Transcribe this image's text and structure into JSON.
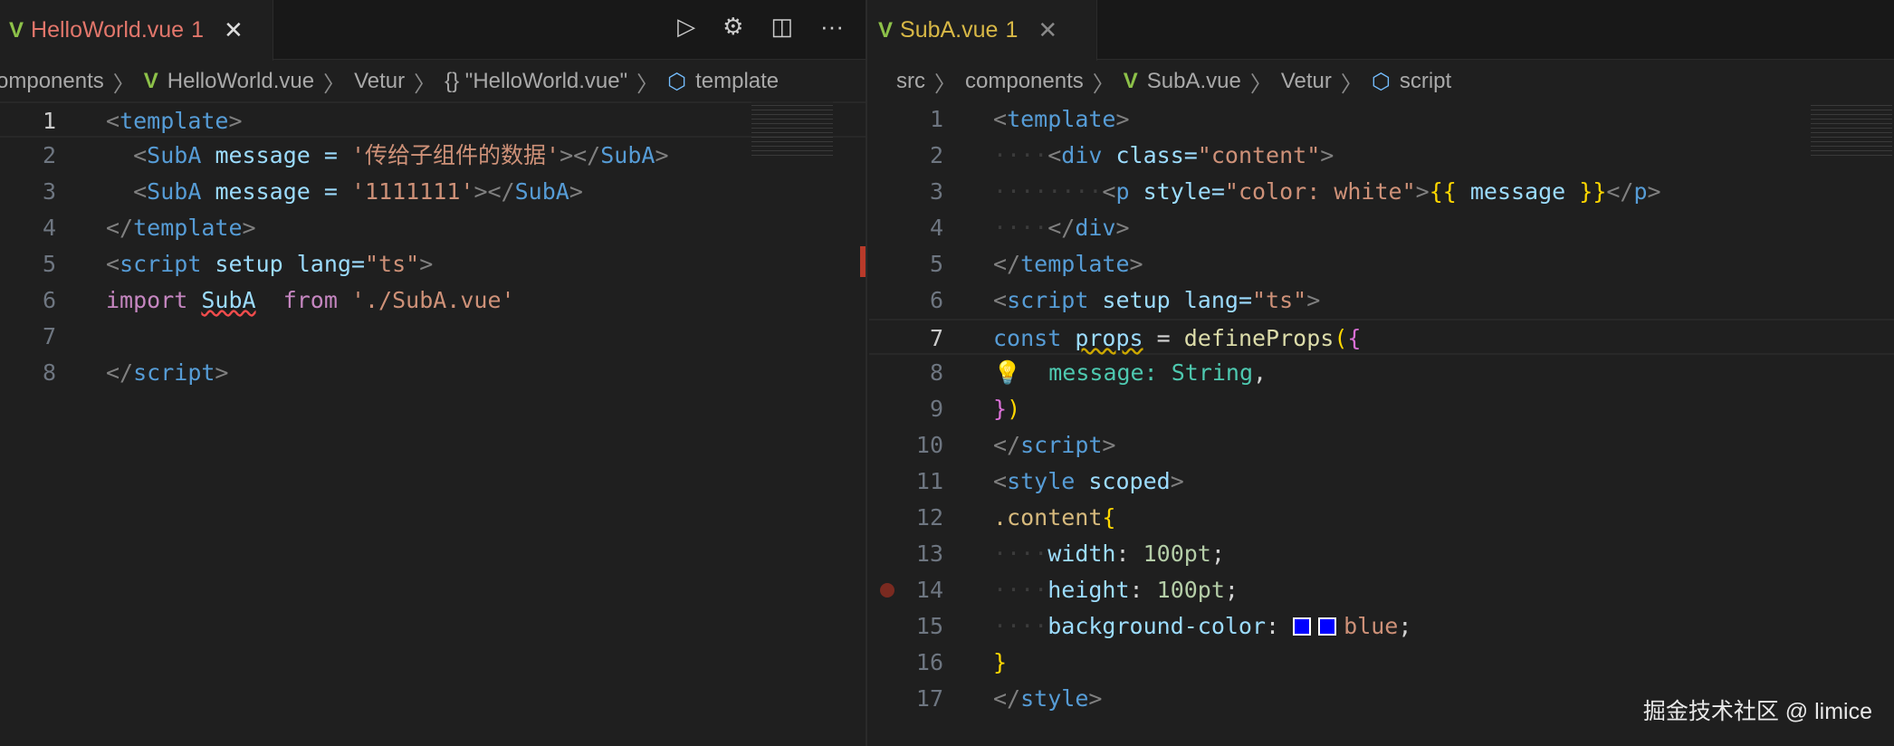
{
  "left": {
    "tab": {
      "icon": "vue-icon",
      "name": "HelloWorld.vue",
      "problems": "1",
      "color": "#e2766b"
    },
    "actions": [
      "run-icon",
      "device-gear-icon",
      "split-editor-icon",
      "more-icon"
    ],
    "breadcrumbs": [
      "omponents",
      "HelloWorld.vue",
      "Vetur",
      "{} \"HelloWorld.vue\"",
      "template"
    ],
    "current_line": 1,
    "lines": [
      [
        {
          "t": "<",
          "c": "br"
        },
        {
          "t": "template",
          "c": "tag"
        },
        {
          "t": ">",
          "c": "br"
        }
      ],
      [
        {
          "t": "  ",
          "c": "ws"
        },
        {
          "t": "<",
          "c": "br"
        },
        {
          "t": "SubA",
          "c": "tag"
        },
        {
          "t": " message = ",
          "c": "attr"
        },
        {
          "t": "'传给子组件的数据'",
          "c": "str"
        },
        {
          "t": "></",
          "c": "br"
        },
        {
          "t": "SubA",
          "c": "tag"
        },
        {
          "t": ">",
          "c": "br"
        }
      ],
      [
        {
          "t": "  ",
          "c": "ws"
        },
        {
          "t": "<",
          "c": "br"
        },
        {
          "t": "SubA",
          "c": "tag"
        },
        {
          "t": " message = ",
          "c": "attr"
        },
        {
          "t": "'1111111'",
          "c": "str"
        },
        {
          "t": "></",
          "c": "br"
        },
        {
          "t": "SubA",
          "c": "tag"
        },
        {
          "t": ">",
          "c": "br"
        }
      ],
      [
        {
          "t": "</",
          "c": "br"
        },
        {
          "t": "template",
          "c": "tag"
        },
        {
          "t": ">",
          "c": "br"
        }
      ],
      [
        {
          "t": "<",
          "c": "br"
        },
        {
          "t": "script",
          "c": "tag"
        },
        {
          "t": " setup lang=",
          "c": "attr"
        },
        {
          "t": "\"ts\"",
          "c": "str"
        },
        {
          "t": ">",
          "c": "br"
        }
      ],
      [
        {
          "t": "import ",
          "c": "imp"
        },
        {
          "t": "SubA",
          "c": "attr squig"
        },
        {
          "t": "  ",
          "c": "plain"
        },
        {
          "t": "from ",
          "c": "imp"
        },
        {
          "t": "'./SubA.vue'",
          "c": "str"
        }
      ],
      [],
      [
        {
          "t": "</",
          "c": "br"
        },
        {
          "t": "script",
          "c": "tag"
        },
        {
          "t": ">",
          "c": "br"
        }
      ]
    ]
  },
  "right": {
    "tab": {
      "icon": "vue-icon",
      "name": "SubA.vue",
      "problems": "1",
      "color": "#d8b846"
    },
    "breadcrumbs": [
      "src",
      "components",
      "SubA.vue",
      "Vetur",
      "script"
    ],
    "current_line": 7,
    "breakpoint_line": 14,
    "lines": [
      [
        {
          "t": "<",
          "c": "br"
        },
        {
          "t": "template",
          "c": "tag"
        },
        {
          "t": ">",
          "c": "br"
        }
      ],
      [
        {
          "t": "····",
          "c": "ws"
        },
        {
          "t": "<",
          "c": "br"
        },
        {
          "t": "div",
          "c": "tag"
        },
        {
          "t": " class=",
          "c": "attr"
        },
        {
          "t": "\"content\"",
          "c": "str"
        },
        {
          "t": ">",
          "c": "br"
        }
      ],
      [
        {
          "t": "········",
          "c": "ws"
        },
        {
          "t": "<",
          "c": "br"
        },
        {
          "t": "p",
          "c": "tag"
        },
        {
          "t": " style=",
          "c": "attr"
        },
        {
          "t": "\"color: white\"",
          "c": "str"
        },
        {
          "t": ">",
          "c": "br"
        },
        {
          "t": "{{",
          "c": "brace"
        },
        {
          "t": " message ",
          "c": "attr"
        },
        {
          "t": "}}",
          "c": "brace"
        },
        {
          "t": "</",
          "c": "br"
        },
        {
          "t": "p",
          "c": "tag"
        },
        {
          "t": ">",
          "c": "br"
        }
      ],
      [
        {
          "t": "····",
          "c": "ws"
        },
        {
          "t": "</",
          "c": "br"
        },
        {
          "t": "div",
          "c": "tag"
        },
        {
          "t": ">",
          "c": "br"
        }
      ],
      [
        {
          "t": "</",
          "c": "br"
        },
        {
          "t": "template",
          "c": "tag"
        },
        {
          "t": ">",
          "c": "br"
        }
      ],
      [
        {
          "t": "<",
          "c": "br"
        },
        {
          "t": "script",
          "c": "tag"
        },
        {
          "t": " setup lang=",
          "c": "attr"
        },
        {
          "t": "\"ts\"",
          "c": "str"
        },
        {
          "t": ">",
          "c": "br"
        }
      ],
      [
        {
          "t": "const ",
          "c": "kw"
        },
        {
          "t": "props",
          "c": "attr squigy"
        },
        {
          "t": " = ",
          "c": "plain"
        },
        {
          "t": "defineProps",
          "c": "fn"
        },
        {
          "t": "(",
          "c": "brace"
        },
        {
          "t": "{",
          "c": "brace2"
        }
      ],
      [
        {
          "t": "💡",
          "c": "bulb"
        },
        {
          "t": "  ",
          "c": "ws"
        },
        {
          "t": "message: ",
          "c": "type"
        },
        {
          "t": "String",
          "c": "type"
        },
        {
          "t": ",",
          "c": "plain"
        }
      ],
      [
        {
          "t": "}",
          "c": "brace2"
        },
        {
          "t": ")",
          "c": "brace"
        }
      ],
      [
        {
          "t": "</",
          "c": "br"
        },
        {
          "t": "script",
          "c": "tag"
        },
        {
          "t": ">",
          "c": "br"
        }
      ],
      [
        {
          "t": "<",
          "c": "br"
        },
        {
          "t": "style",
          "c": "tag"
        },
        {
          "t": " scoped",
          "c": "attr"
        },
        {
          "t": ">",
          "c": "br"
        }
      ],
      [
        {
          "t": ".content",
          "c": "sel"
        },
        {
          "t": "{",
          "c": "brace"
        }
      ],
      [
        {
          "t": "····",
          "c": "ws"
        },
        {
          "t": "width",
          "c": "prop"
        },
        {
          "t": ": ",
          "c": "plain"
        },
        {
          "t": "100pt",
          "c": "num"
        },
        {
          "t": ";",
          "c": "plain"
        }
      ],
      [
        {
          "t": "····",
          "c": "ws"
        },
        {
          "t": "height",
          "c": "prop"
        },
        {
          "t": ": ",
          "c": "plain"
        },
        {
          "t": "100pt",
          "c": "num"
        },
        {
          "t": ";",
          "c": "plain"
        }
      ],
      [
        {
          "t": "····",
          "c": "ws"
        },
        {
          "t": "background-color",
          "c": "prop"
        },
        {
          "t": ": ",
          "c": "plain"
        },
        {
          "t": "",
          "c": "swatch"
        },
        {
          "t": "",
          "c": "swatch"
        },
        {
          "t": "blue",
          "c": "str"
        },
        {
          "t": ";",
          "c": "plain"
        }
      ],
      [
        {
          "t": "}",
          "c": "brace"
        }
      ],
      [
        {
          "t": "</",
          "c": "br"
        },
        {
          "t": "style",
          "c": "tag"
        },
        {
          "t": ">",
          "c": "br"
        }
      ]
    ]
  },
  "watermark": "掘金技术社区 @ limice"
}
